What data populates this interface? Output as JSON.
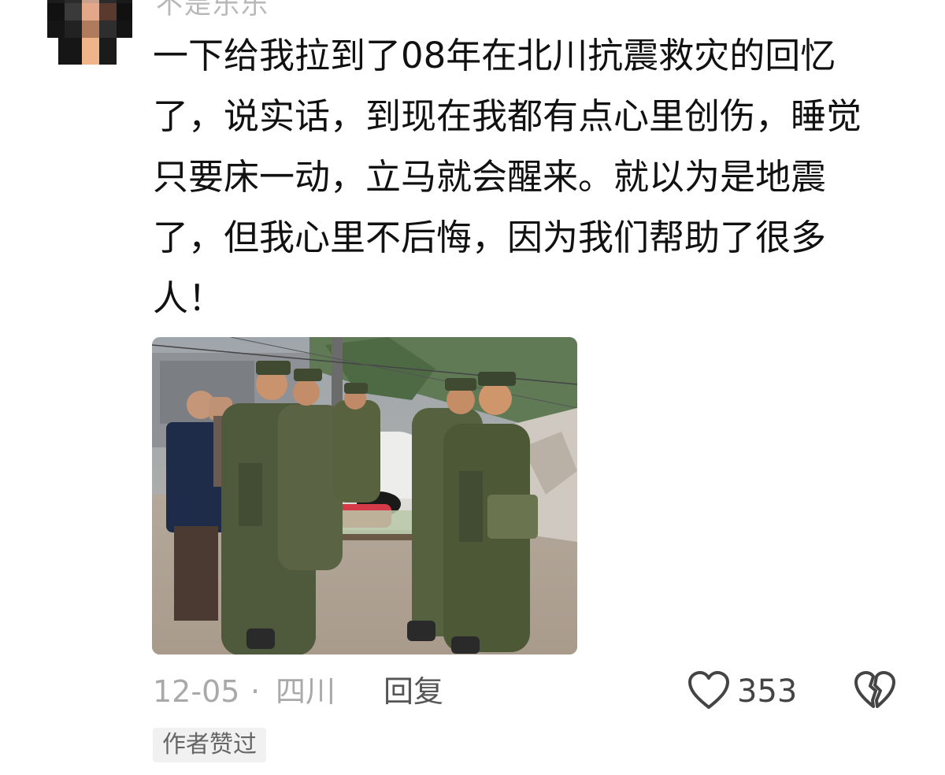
{
  "comment": {
    "username": "不是乐乐",
    "text": "一下给我拉到了08年在北川抗震救灾的回忆了，说实话，到现在我都有点心里创伤，睡觉只要床一动，立马就会醒来。就以为是地震了，但我心里不后悔，因为我们帮助了很多人！",
    "date": "12-05",
    "separator": "·",
    "location": "四川",
    "reply_label": "回复",
    "like_count": "353",
    "author_badge": "作者赞过"
  },
  "icons": {
    "like": "heart-outline-icon",
    "dislike": "broken-heart-icon"
  },
  "colors": {
    "text": "#111111",
    "meta": "#a9a9a9",
    "badge_bg": "#f1f1f1"
  }
}
